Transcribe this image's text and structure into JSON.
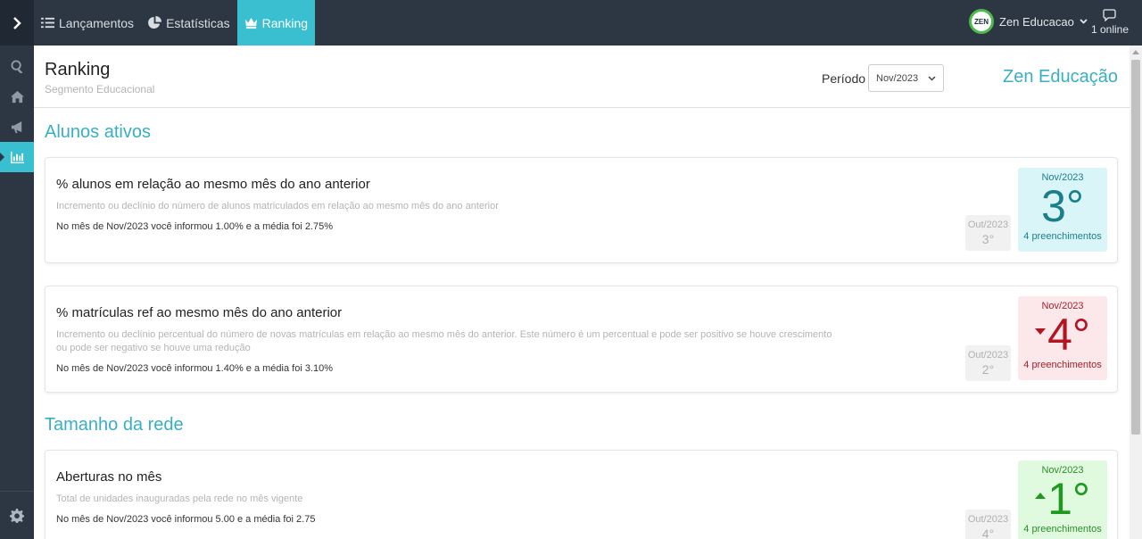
{
  "topbar": {
    "toggle_icon": "chevron-right-icon",
    "nav": [
      {
        "label": "Lançamentos",
        "icon": "list-icon"
      },
      {
        "label": "Estatísticas",
        "icon": "pie-chart-icon"
      },
      {
        "label": "Ranking",
        "icon": "crown-icon",
        "active": true
      }
    ],
    "user": {
      "avatar_text": "ZEN",
      "name": "Zen Educacao"
    },
    "online": "1 online"
  },
  "sidebar": {
    "items": [
      "search-icon",
      "home-icon",
      "megaphone-icon",
      "bar-chart-icon"
    ],
    "bottom": "gear-icon"
  },
  "header": {
    "title": "Ranking",
    "subtitle": "Segmento Educacional",
    "periodo_label": "Período",
    "periodo_value": "Nov/2023",
    "brand": "Zen Educação"
  },
  "sections": [
    {
      "title": "Alunos ativos",
      "cards": [
        {
          "title": "% alunos em relação ao mesmo mês do ano anterior",
          "description": "Incremento ou declínio do número de alunos matriculados em relação ao mesmo mês do ano anterior",
          "info": "No mês de Nov/2023 você informou 1.00% e a média foi 2.75%",
          "prev_month": "Out/2023",
          "prev_rank": "3°",
          "month": "Nov/2023",
          "rank": "3°",
          "count": "4 preenchimentos",
          "trend": "none"
        },
        {
          "title": "% matrículas ref ao mesmo mês do ano anterior",
          "description": "Incremento ou declínio percentual do número de novas matrículas em relação ao mesmo mês do anterior. Este número é um percentual e pode ser positivo se houve crescimento ou pode ser negativo se houve uma redução",
          "info": "No mês de Nov/2023 você informou 1.40% e a média foi 3.10%",
          "prev_month": "Out/2023",
          "prev_rank": "2°",
          "month": "Nov/2023",
          "rank": "4°",
          "count": "4 preenchimentos",
          "trend": "down"
        }
      ]
    },
    {
      "title": "Tamanho da rede",
      "cards": [
        {
          "title": "Aberturas no mês",
          "description": "Total de unidades inauguradas pela rede no mês vigente",
          "info": "No mês de Nov/2023 você informou 5.00 e a média foi 2.75",
          "prev_month": "Out/2023",
          "prev_rank": "4°",
          "month": "Nov/2023",
          "rank": "1°",
          "count": "4 preenchimentos",
          "trend": "up"
        }
      ]
    }
  ]
}
